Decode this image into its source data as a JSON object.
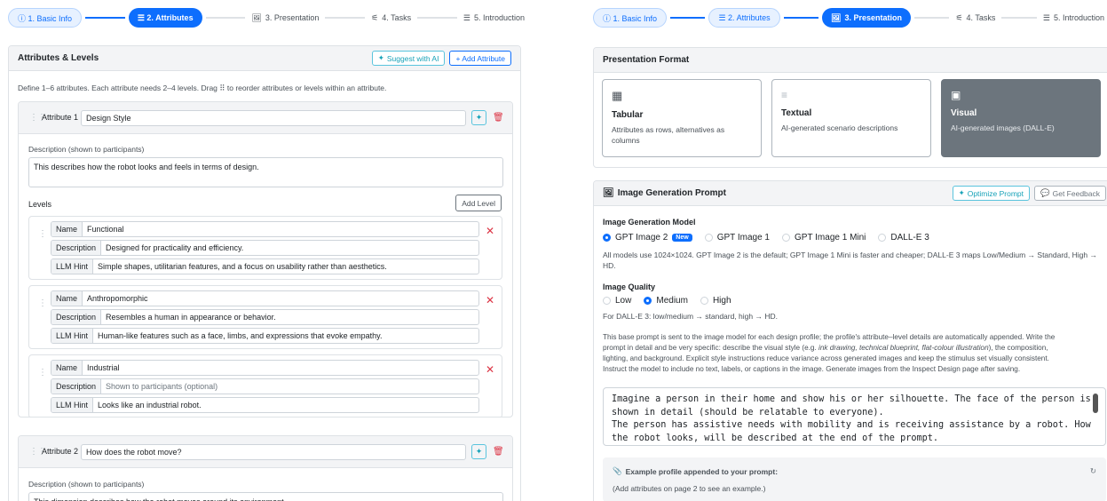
{
  "left": {
    "steps": [
      "ⓘ 1. Basic Info",
      "☰ 2. Attributes",
      "3. Presentation",
      "4. Tasks",
      "5. Introduction"
    ],
    "card_title": "Attributes & Levels",
    "suggest_btn": "Suggest with AI",
    "add_attr_btn": "+ Add Attribute",
    "intro": "Define 1–6 attributes. Each attribute needs 2–4 levels. Drag ⠿ to reorder attributes or levels within an attribute.",
    "attr1": {
      "label": "Attribute 1",
      "name": "Design Style",
      "desc_label": "Description (shown to participants)",
      "desc": "This describes how the robot looks and feels in terms of design.",
      "levels_label": "Levels",
      "add_level": "Add Level",
      "levels": [
        {
          "name": "Functional",
          "desc": "Designed for practicality and efficiency.",
          "hint": "Simple shapes, utilitarian features, and a focus on usability rather than aesthetics."
        },
        {
          "name": "Anthropomorphic",
          "desc": "Resembles a human in appearance or behavior.",
          "hint": "Human-like features such as a face, limbs, and expressions that evoke empathy."
        },
        {
          "name": "Industrial",
          "desc": "Shown to participants (optional)",
          "hint": "Looks like an industrial robot."
        }
      ]
    },
    "attr2": {
      "label": "Attribute 2",
      "name": "How does the robot move?",
      "desc_label": "Description (shown to participants)",
      "desc": "This dimension describes how the robot moves around its environment"
    },
    "k_name": "Name",
    "k_desc": "Description",
    "k_hint": "LLM Hint"
  },
  "right": {
    "steps": [
      "ⓘ 1. Basic Info",
      "☰ 2. Attributes",
      "3. Presentation",
      "4. Tasks",
      "5. Introduction"
    ],
    "format_title": "Presentation Format",
    "formats": [
      {
        "title": "Tabular",
        "desc": "Attributes as rows, alternatives as columns"
      },
      {
        "title": "Textual",
        "desc": "AI-generated scenario descriptions"
      },
      {
        "title": "Visual",
        "desc": "AI-generated images (DALL-E)"
      }
    ],
    "prompt_title": "Image Generation Prompt",
    "optimize_btn": "Optimize Prompt",
    "feedback_btn": "Get Feedback",
    "model_label": "Image Generation Model",
    "models": [
      "GPT Image 2",
      "GPT Image 1",
      "GPT Image 1 Mini",
      "DALL-E 3"
    ],
    "new_badge": "New",
    "model_note": "All models use 1024×1024. GPT Image 2 is the default; GPT Image 1 Mini is faster and cheaper; DALL-E 3 maps Low/Medium → Standard, High → HD.",
    "quality_label": "Image Quality",
    "qualities": [
      "Low",
      "Medium",
      "High"
    ],
    "quality_note": "For DALL-E 3: low/medium → standard, high → HD.",
    "base_note_1": "This base prompt is sent to the image model for each design profile; the profile's attribute–level details are automatically appended. Write the",
    "base_note_2a": "prompt in detail and be very specific: describe the visual style (e.g.",
    "base_note_2b": "ink drawing, technical blueprint, flat-colour illustration",
    "base_note_2c": "), the composition,",
    "base_note_3": "lighting, and background. Explicit style instructions reduce variance across generated images and keep the stimulus set visually consistent.",
    "base_note_4": "Instruct the model to include no text, labels, or captions in the image. Generate images from the Inspect Design page after saving.",
    "prompt_lines": [
      "Imagine a person in their home and show his or her silhouette. The face of the person is",
      "shown in detail (should be relatable to everyone).",
      "The person has assistive needs with mobility and is receiving assistance by a robot. How",
      "the robot looks, will be described at the end of the prompt."
    ],
    "example_label": "Example profile appended to your prompt:",
    "example_text": "(Add attributes on page 2 to see an example.)"
  }
}
